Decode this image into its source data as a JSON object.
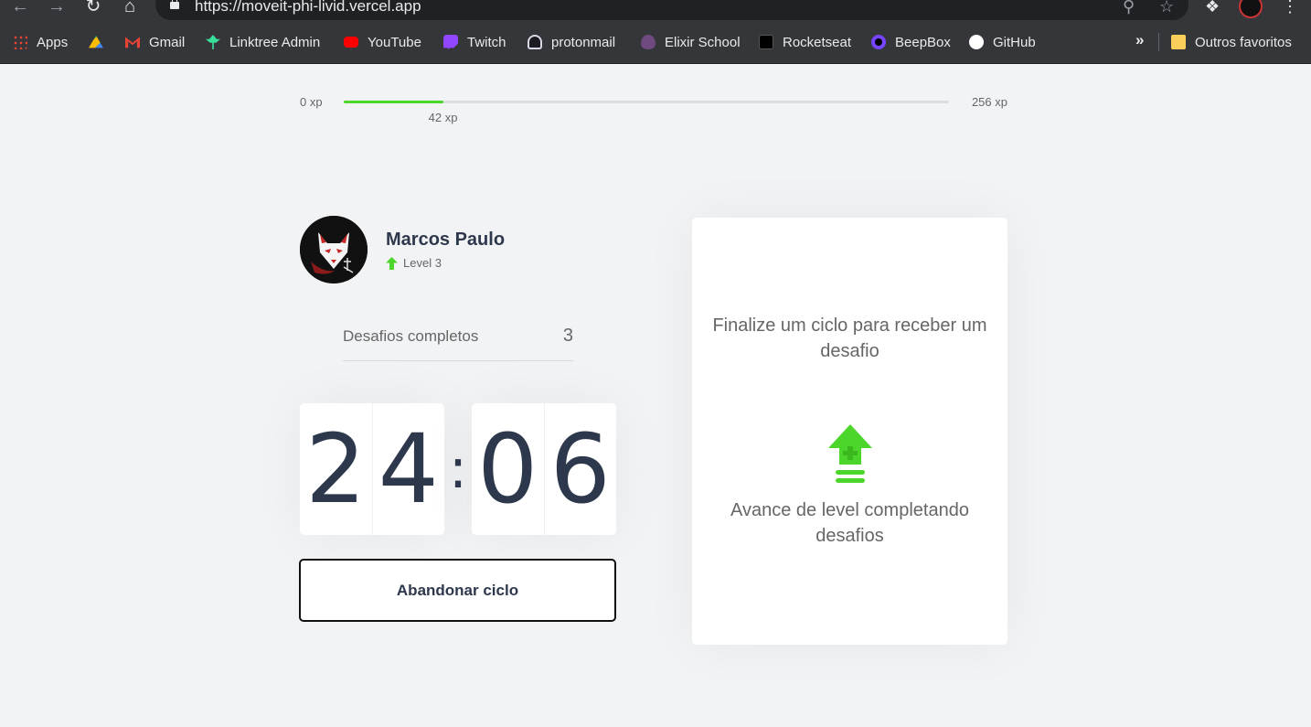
{
  "browser": {
    "url": "https://moveit-phi-livid.vercel.app",
    "bookmarks": [
      {
        "label": "Apps",
        "icon": "apps-grid-icon",
        "color": "#ea4335"
      },
      {
        "label": "",
        "icon": "google-drive-icon",
        "color": "#fbbc04"
      },
      {
        "label": "Gmail",
        "icon": "gmail-icon",
        "color": "#ea4335"
      },
      {
        "label": "Linktree Admin",
        "icon": "linktree-icon",
        "color": "#39e09b"
      },
      {
        "label": "YouTube",
        "icon": "youtube-icon",
        "color": "#ff0000"
      },
      {
        "label": "Twitch",
        "icon": "twitch-icon",
        "color": "#9146ff"
      },
      {
        "label": "protonmail",
        "icon": "protonmail-icon",
        "color": "#6d4aff"
      },
      {
        "label": "Elixir School",
        "icon": "elixir-icon",
        "color": "#6e4a7e"
      },
      {
        "label": "Rocketseat",
        "icon": "rocketseat-icon",
        "color": "#000000"
      },
      {
        "label": "BeepBox",
        "icon": "beepbox-icon",
        "color": "#7744ff"
      },
      {
        "label": "GitHub",
        "icon": "github-icon",
        "color": "#ffffff"
      }
    ],
    "more": "»",
    "other_bookmarks": "Outros favoritos"
  },
  "experience": {
    "min_label": "0 xp",
    "max_label": "256 xp",
    "current_label": "42 xp",
    "progress_fraction": 0.164,
    "color": "#4cd62b"
  },
  "profile": {
    "name": "Marcos Paulo",
    "level": "Level 3"
  },
  "completed": {
    "label": "Desafios completos",
    "count": "3"
  },
  "countdown": {
    "minute_left": "2",
    "minute_right": "4",
    "separator": ":",
    "second_left": "0",
    "second_right": "6"
  },
  "button": {
    "abandon_label": "Abandonar ciclo"
  },
  "challenge": {
    "title": "Finalize um ciclo para receber um desafio",
    "hint": "Avance de level completando desafios"
  }
}
